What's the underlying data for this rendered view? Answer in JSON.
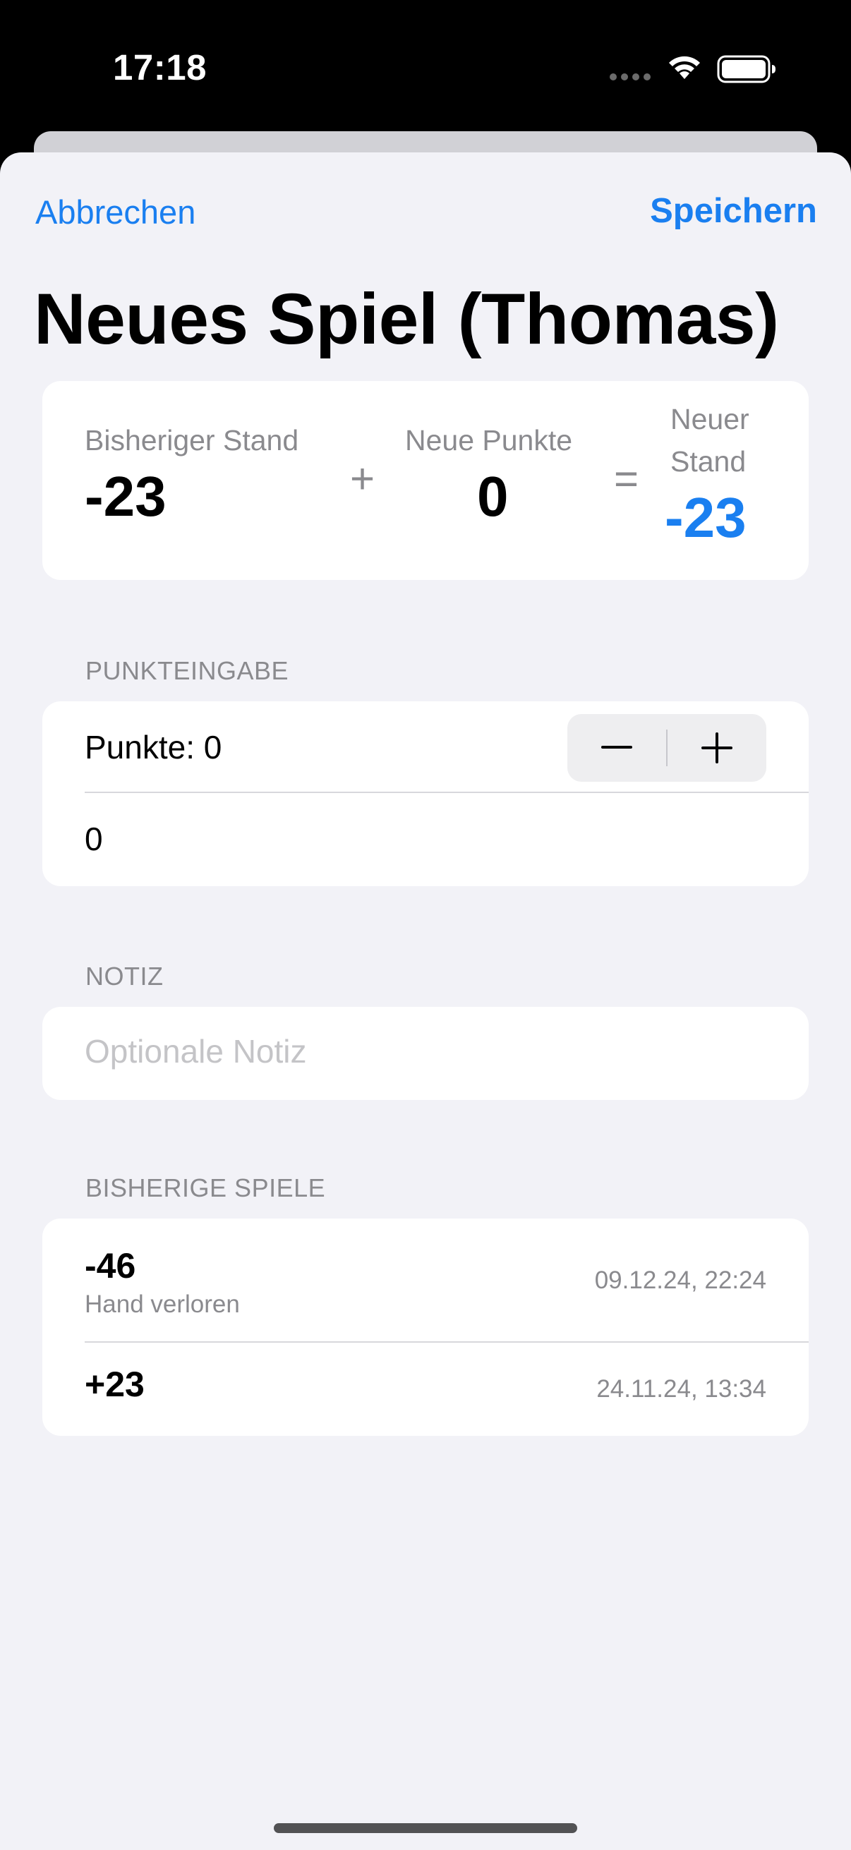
{
  "status_bar": {
    "time": "17:18"
  },
  "nav": {
    "cancel_label": "Abbrechen",
    "save_label": "Speichern"
  },
  "title": "Neues Spiel (Thomas)",
  "summary": {
    "previous_label": "Bisheriger Stand",
    "previous_value": "-23",
    "plus_sign": "+",
    "new_points_label": "Neue Punkte",
    "new_points_value": "0",
    "equals_sign": "=",
    "new_total_label_line1": "Neuer",
    "new_total_label_line2": "Stand",
    "new_total_value": "-23",
    "accent_color": "#1a7ff0"
  },
  "points_section": {
    "header": "PUNKTEINGABE",
    "stepper_label": "Punkte: 0",
    "input_value": "0"
  },
  "note_section": {
    "header": "NOTIZ",
    "placeholder": "Optionale Notiz"
  },
  "games_section": {
    "header": "BISHERIGE SPIELE",
    "games": [
      {
        "score": "-46",
        "note": "Hand verloren",
        "date": "09.12.24, 22:24"
      },
      {
        "score": "+23",
        "note": "",
        "date": "24.11.24, 13:34"
      }
    ]
  }
}
